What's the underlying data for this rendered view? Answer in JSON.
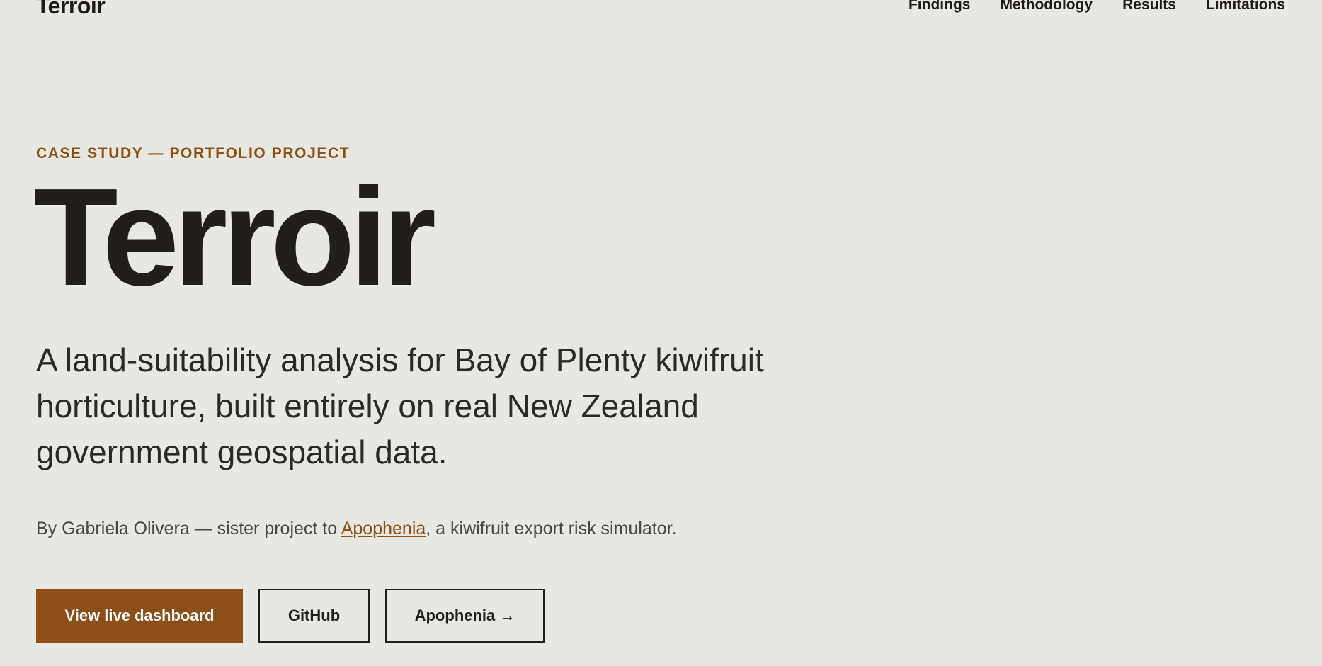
{
  "header": {
    "logo": "Terroir",
    "nav": {
      "findings": "Findings",
      "methodology": "Methodology",
      "results": "Results",
      "limitations": "Limitations"
    }
  },
  "hero": {
    "eyebrow": "CASE STUDY — PORTFOLIO PROJECT",
    "title": "Terroir",
    "subtitle": "A land-suitability analysis for Bay of Plenty kiwifruit horticulture, built entirely on real New Zealand government geospatial data.",
    "byline": {
      "prefix": "By Gabriela Olivera — sister project to ",
      "link_text": "Apophenia",
      "suffix": ", a kiwifruit export risk simulator."
    },
    "buttons": {
      "dashboard": "View live dashboard",
      "github": "GitHub",
      "apophenia": "Apophenia →"
    }
  },
  "colors": {
    "background": "#e8e8e2",
    "text": "#221f1b",
    "accent": "#8c4e12",
    "primary_button": "#8c4f19"
  }
}
